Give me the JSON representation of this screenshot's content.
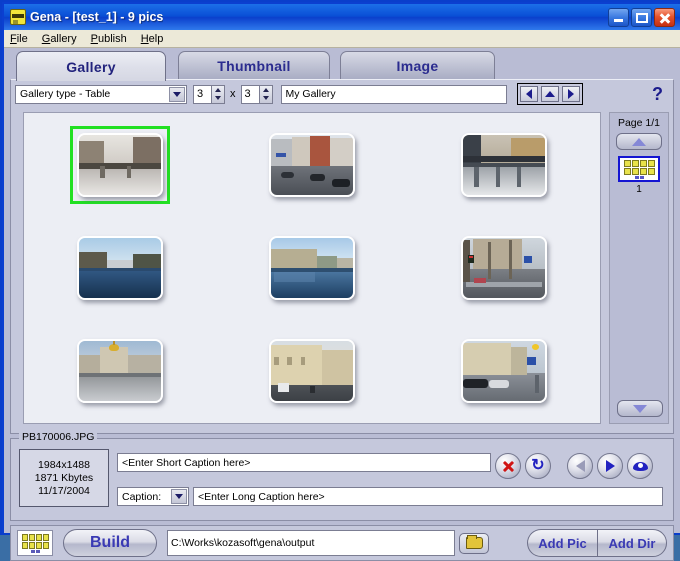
{
  "window": {
    "title": "Gena - [test_1] - 9 pics",
    "app_icon": "app-icon",
    "minimize_label": "Minimize",
    "maximize_label": "Maximize",
    "close_label": "Close"
  },
  "menu": [
    {
      "label": "File",
      "accel": "F"
    },
    {
      "label": "Gallery",
      "accel": "G"
    },
    {
      "label": "Publish",
      "accel": "P"
    },
    {
      "label": "Help",
      "accel": "H"
    }
  ],
  "tabs": [
    {
      "label": "Gallery",
      "active": true
    },
    {
      "label": "Thumbnail",
      "active": false
    },
    {
      "label": "Image",
      "active": false
    }
  ],
  "toolbar": {
    "gallery_type": "Gallery type - Table",
    "rows": "3",
    "x_separator": "x",
    "cols": "3",
    "gallery_name": "My Gallery",
    "nav_prev": "left-arrow",
    "nav_up": "up-arrow",
    "nav_next": "right-arrow",
    "help": "?"
  },
  "gallery": {
    "thumbnails": [
      {
        "index": 1,
        "selected": true,
        "alt": "canal bridge with houses"
      },
      {
        "index": 2,
        "selected": false,
        "alt": "city street with cars"
      },
      {
        "index": 3,
        "selected": false,
        "alt": "iron bridge over canal"
      },
      {
        "index": 4,
        "selected": false,
        "alt": "river with blue sky"
      },
      {
        "index": 5,
        "selected": false,
        "alt": "embankment buildings reflection"
      },
      {
        "index": 6,
        "selected": false,
        "alt": "street with bare trees and traffic light"
      },
      {
        "index": 7,
        "selected": false,
        "alt": "cathedral with golden dome"
      },
      {
        "index": 8,
        "selected": false,
        "alt": "yellow classical building"
      },
      {
        "index": 9,
        "selected": false,
        "alt": "street with parked cars"
      }
    ]
  },
  "pages": {
    "label": "Page 1/1",
    "scroll_up": "up-arrow",
    "scroll_down": "down-arrow",
    "page_number": "1"
  },
  "info": {
    "filename": "PB170006.JPG",
    "dimensions": "1984x1488",
    "filesize": "1871 Kbytes",
    "date": "11/17/2004",
    "short_caption_placeholder": "<Enter Short Caption here>",
    "caption_type": "Caption:",
    "long_caption_placeholder": "<Enter Long Caption here>",
    "buttons": {
      "delete": "delete-x",
      "rotate": "rotate-cw",
      "prev": "prev-arrow",
      "next": "next-arrow",
      "preview": "preview-eye"
    }
  },
  "bottom": {
    "grid_icon": "gallery-grid-icon",
    "build_label": "Build",
    "output_path": "C:\\Works\\kozasoft\\gena\\output",
    "browse_icon": "folder-open-icon",
    "add_pic_label": "Add Pic",
    "add_dir_label": "Add Dir"
  },
  "colors": {
    "title_blue": "#0b3fd0",
    "selection_green": "#22e022",
    "accent_text": "#3a3ab4",
    "panel": "#c5c8dc"
  }
}
